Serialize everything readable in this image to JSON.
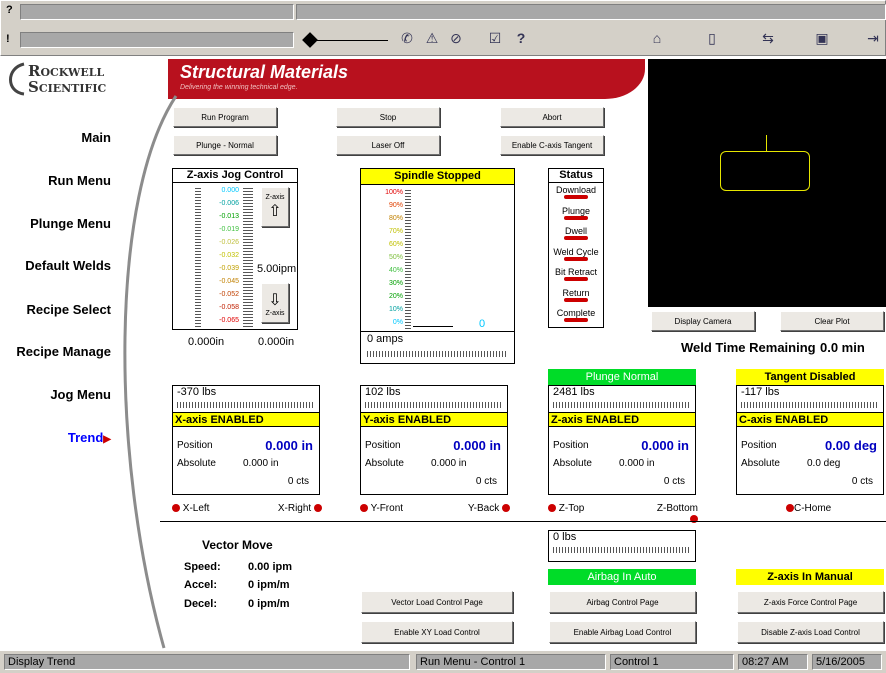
{
  "toolbar": {
    "q_label": "?",
    "bang_label": "!",
    "icons": [
      "tools-icon",
      "warning-icon",
      "stop-icon",
      "checklist-icon",
      "help-icon",
      "home-icon",
      "door-icon",
      "arrows-icon",
      "window-icon",
      "exit-icon"
    ]
  },
  "logo": {
    "line1": "Rockwell",
    "line2": "Scientific"
  },
  "banner": {
    "title": "Structural Materials",
    "subtitle": "Delivering the winning technical edge."
  },
  "nav": {
    "items": [
      "Main",
      "Run Menu",
      "Plunge Menu",
      "Default Welds",
      "Recipe Select",
      "Recipe Manage",
      "Jog Menu",
      "Trend"
    ]
  },
  "buttons": {
    "run_program": "Run Program",
    "stop": "Stop",
    "abort": "Abort",
    "plunge_normal": "Plunge - Normal",
    "laser_off": "Laser Off",
    "enable_c_tangent": "Enable C-axis Tangent",
    "display_camera": "Display Camera",
    "clear_plot": "Clear Plot",
    "vector_load": "Vector Load Control Page",
    "enable_xy": "Enable XY Load Control",
    "airbag_page": "Airbag Control Page",
    "enable_airbag": "Enable Airbag Load Control",
    "zforce_page": "Z-axis Force Control Page",
    "disable_z": "Disable Z-axis Load Control"
  },
  "zjog": {
    "title": "Z-axis Jog Control",
    "scale": [
      "0.000",
      "-0.006",
      "-0.013",
      "-0.019",
      "-0.026",
      "-0.032",
      "-0.039",
      "-0.045",
      "-0.052",
      "-0.058",
      "-0.065"
    ],
    "scale_colors": [
      "#00c8ff",
      "#00a0a0",
      "#00a000",
      "#40c040",
      "#c0c040",
      "#c0c000",
      "#c0a000",
      "#c08000",
      "#c04000",
      "#c02000",
      "#e00000"
    ],
    "btn_label": "Z-axis",
    "rate": "5.00ipm",
    "left_reading": "0.000in",
    "right_reading": "0.000in"
  },
  "spindle": {
    "title": "Spindle Stopped",
    "scale": [
      "100%",
      "90%",
      "80%",
      "70%",
      "60%",
      "50%",
      "40%",
      "30%",
      "20%",
      "10%",
      "0%"
    ],
    "scale_colors": [
      "#e00000",
      "#e04000",
      "#c08000",
      "#c0c000",
      "#c0c000",
      "#80c040",
      "#40c040",
      "#00a000",
      "#00a000",
      "#00a0a0",
      "#00c8ff"
    ],
    "value": "0",
    "amps": "0 amps"
  },
  "status": {
    "title": "Status",
    "items": [
      "Download",
      "Plunge",
      "Dwell",
      "Weld Cycle",
      "Bit Retract",
      "Return",
      "Complete"
    ]
  },
  "weld_time": {
    "label": "Weld Time Remaining",
    "value": "0.0 min"
  },
  "axes": [
    {
      "banner": "",
      "force": "-370 lbs",
      "state": "X-axis ENABLED",
      "pos_label": "Position",
      "pos": "0.000 in",
      "abs_label": "Absolute",
      "abs": "0.000 in",
      "cts": "0 cts",
      "limit_left": "X-Left",
      "limit_right": "X-Right"
    },
    {
      "banner": "",
      "force": "102 lbs",
      "state": "Y-axis ENABLED",
      "pos_label": "Position",
      "pos": "0.000 in",
      "abs_label": "Absolute",
      "abs": "0.000 in",
      "cts": "0 cts",
      "limit_left": "Y-Front",
      "limit_right": "Y-Back"
    },
    {
      "banner": "Plunge Normal",
      "force": "2481 lbs",
      "state": "Z-axis ENABLED",
      "pos_label": "Position",
      "pos": "0.000 in",
      "abs_label": "Absolute",
      "abs": "0.000 in",
      "cts": "0 cts",
      "limit_left": "Z-Top",
      "limit_right": "Z-Bottom"
    },
    {
      "banner": "Tangent Disabled",
      "force": "-117 lbs",
      "state": "C-axis ENABLED",
      "pos_label": "Position",
      "pos": "0.00 deg",
      "abs_label": "Absolute",
      "abs": "0.0 deg",
      "cts": "0 cts",
      "limit_left": "",
      "limit_right": "C-Home"
    }
  ],
  "vector": {
    "title": "Vector Move",
    "speed_label": "Speed:",
    "speed": "0.00 ipm",
    "accel_label": "Accel:",
    "accel": "0 ipm/m",
    "decel_label": "Decel:",
    "decel": "0 ipm/m"
  },
  "airbag": {
    "force": "0 lbs",
    "mode": "Airbag In Auto"
  },
  "zmanual": {
    "mode": "Z-axis In Manual"
  },
  "statusbar": {
    "left": "Display Trend",
    "middle": "Run Menu - Control 1",
    "control": "Control 1",
    "time": "08:27 AM",
    "date": "5/16/2005"
  }
}
